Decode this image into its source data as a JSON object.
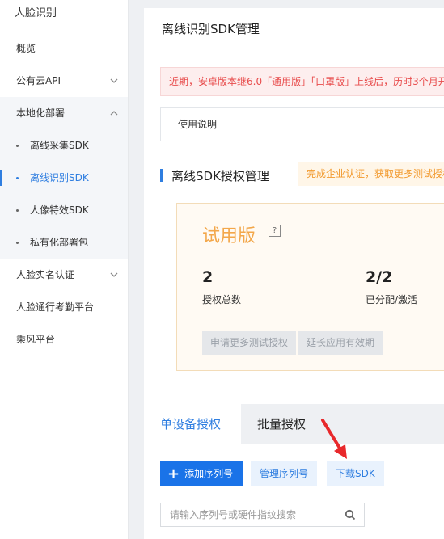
{
  "sidebar": {
    "title": "人脸识别",
    "items": [
      {
        "label": "概览"
      },
      {
        "label": "公有云API"
      },
      {
        "label": "本地化部署"
      },
      {
        "label": "离线采集SDK"
      },
      {
        "label": "离线识别SDK"
      },
      {
        "label": "人像特效SDK"
      },
      {
        "label": "私有化部署包"
      },
      {
        "label": "人脸实名认证"
      },
      {
        "label": "人脸通行考勤平台"
      },
      {
        "label": "乘风平台"
      }
    ]
  },
  "main": {
    "page_title": "离线识别SDK管理",
    "notice": "近期，安卓版本继6.0「通用版」「口罩版」上线后，历时3个月开",
    "usage_label": "使用说明",
    "section_title": "离线SDK授权管理",
    "section_tip": "完成企业认证，获取更多测试授权",
    "trial": {
      "title": "试用版",
      "help": "?",
      "total_value": "2",
      "total_label": "授权总数",
      "assigned_value": "2/2",
      "assigned_label": "已分配/激活",
      "apply_button": "申请更多测试授权",
      "extend_button": "延长应用有效期"
    },
    "tabs": [
      {
        "label": "单设备授权"
      },
      {
        "label": "批量授权"
      }
    ],
    "buttons": {
      "add_serial": "添加序列号",
      "manage_serial": "管理序列号",
      "download_sdk": "下载SDK"
    },
    "search": {
      "placeholder": "请输入序列号或硬件指纹搜索"
    }
  },
  "colors": {
    "accent": "#2f7ee0",
    "primary_button": "#1a73e8",
    "notice_text": "#e84c4c",
    "trial_title": "#f3a74a",
    "arrow": "#e8282b"
  }
}
